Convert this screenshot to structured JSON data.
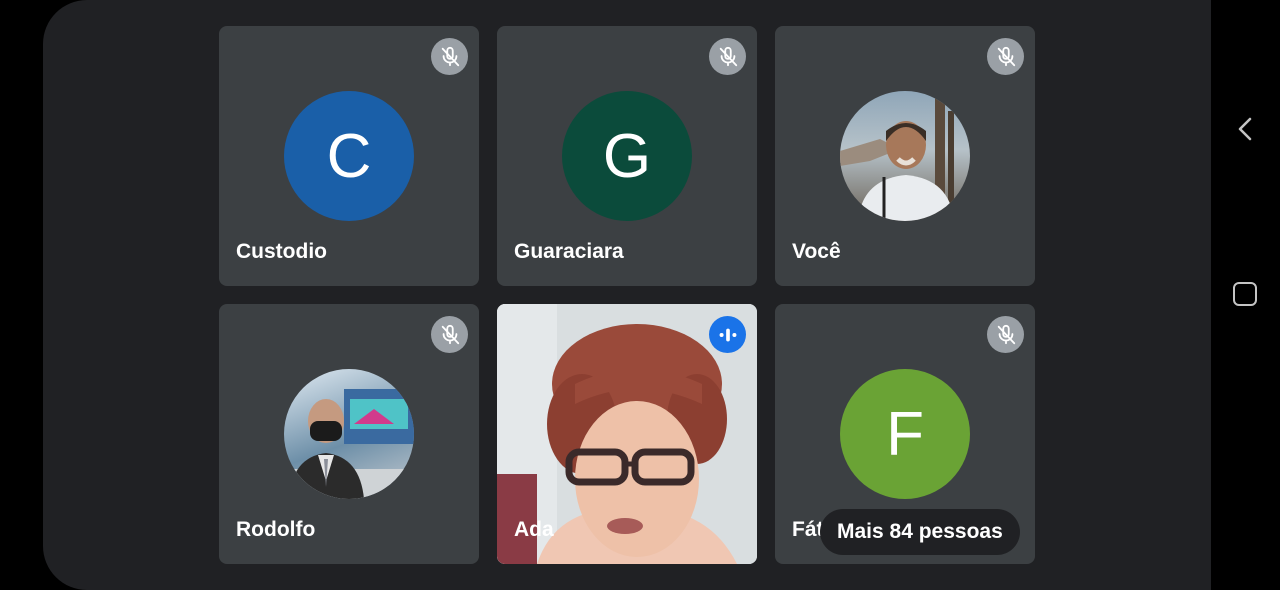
{
  "participants": [
    {
      "name": "Custodio",
      "initial": "C",
      "color": "#1a5fa8",
      "muted": true
    },
    {
      "name": "Guaraciara",
      "initial": "G",
      "color": "#0b4b3b",
      "muted": true
    },
    {
      "name": "Você",
      "initial": "",
      "muted": true,
      "avatar": "photo"
    },
    {
      "name": "Rodolfo",
      "initial": "",
      "muted": true,
      "avatar": "photo"
    },
    {
      "name": "Ada",
      "initial": "",
      "muted": false,
      "speaking": true,
      "video": "live"
    },
    {
      "name": "Fátima",
      "visible_name": "Fát",
      "initial": "F",
      "color": "#6aa335",
      "muted": true
    }
  ],
  "overflow": {
    "label": "Mais 84 pessoas"
  },
  "icons": {
    "muted": "mic-off-icon",
    "speaking": "audio-level-icon",
    "nav_back": "chevron-left-icon",
    "nav_home": "rounded-square-icon"
  }
}
